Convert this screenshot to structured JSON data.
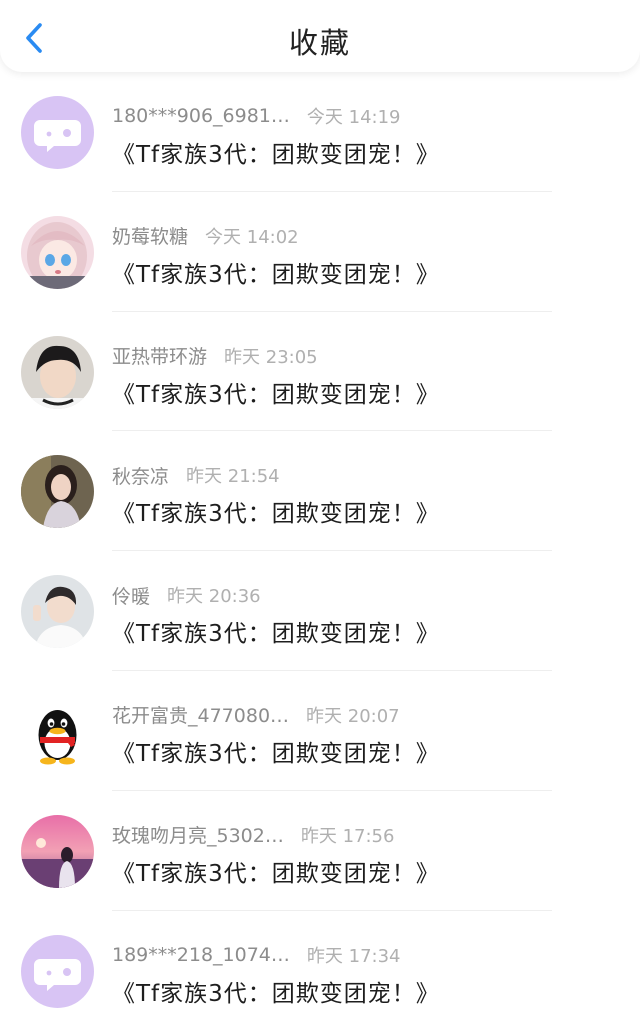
{
  "header": {
    "title": "收藏",
    "back_icon": "chevron-left-icon",
    "accent": "#2a8bf2"
  },
  "items": [
    {
      "avatar": "chat-bubble-default",
      "username": "180***906_6981…",
      "time": "今天 14:19",
      "title": "《Tf家族3代：团欺变团宠！》"
    },
    {
      "avatar": "anime-girl-photo",
      "username": "奶莓软糖",
      "time": "今天 14:02",
      "title": "《Tf家族3代：团欺变团宠！》"
    },
    {
      "avatar": "boy-photo",
      "username": "亚热带环游",
      "time": "昨天 23:05",
      "title": "《Tf家族3代：团欺变团宠！》"
    },
    {
      "avatar": "girl-photo",
      "username": "秋奈凉",
      "time": "昨天 21:54",
      "title": "《Tf家族3代：团欺变团宠！》"
    },
    {
      "avatar": "boy-peace-sign-photo",
      "username": "伶暖",
      "time": "昨天 20:36",
      "title": "《Tf家族3代：团欺变团宠！》"
    },
    {
      "avatar": "qq-penguin",
      "username": "花开富贵_477080…",
      "time": "昨天 20:07",
      "title": "《Tf家族3代：团欺变团宠！》"
    },
    {
      "avatar": "sunset-girl-photo",
      "username": "玫瑰吻月亮_5302…",
      "time": "昨天 17:56",
      "title": "《Tf家族3代：团欺变团宠！》"
    },
    {
      "avatar": "chat-bubble-default",
      "username": "189***218_1074…",
      "time": "昨天 17:34",
      "title": "《Tf家族3代：团欺变团宠！》"
    }
  ]
}
